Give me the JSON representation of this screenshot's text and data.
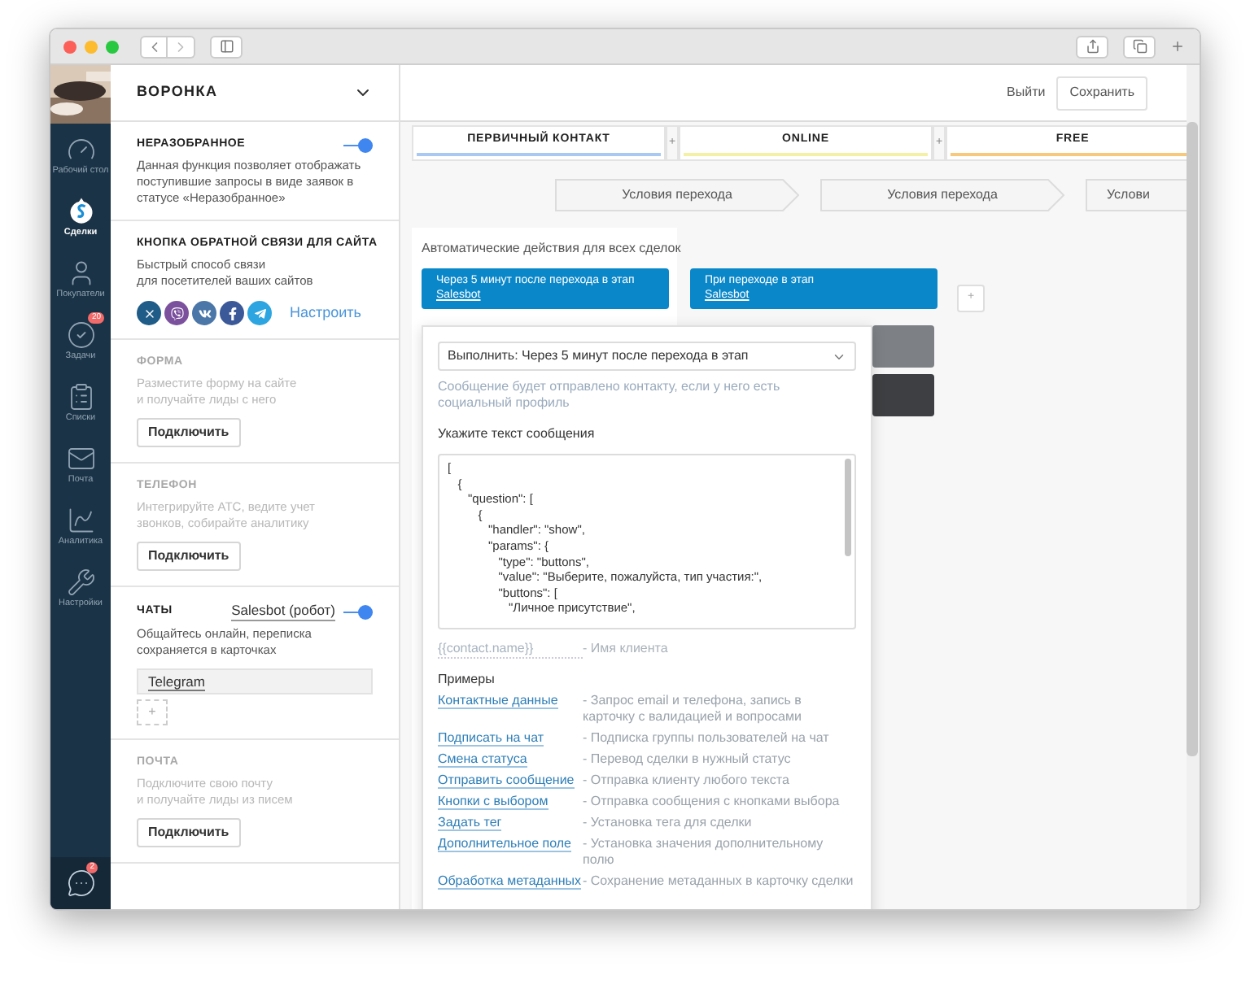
{
  "nav": {
    "items": [
      {
        "label": "Рабочий стол",
        "selected": false
      },
      {
        "label": "Сделки",
        "selected": true
      },
      {
        "label": "Покупатели",
        "selected": false
      },
      {
        "label": "Задачи",
        "selected": false,
        "badge": "20"
      },
      {
        "label": "Списки",
        "selected": false
      },
      {
        "label": "Почта",
        "selected": false
      },
      {
        "label": "Аналитика",
        "selected": false
      },
      {
        "label": "Настройки",
        "selected": false
      }
    ],
    "chat_badge": "2"
  },
  "panel": {
    "title": "ВОРОНКА",
    "sections": [
      {
        "title": "НЕРАЗОБРАННОЕ",
        "disabled": false,
        "toggle": {
          "on": true
        },
        "description": "Данная функция позволяет отображать\nпоступившие запросы в виде заявок в\nстатусе «Неразобранное»"
      },
      {
        "title": "КНОПКА ОБРАТНОЙ СВЯЗИ ДЛЯ САЙТА",
        "disabled": false,
        "description": "Быстрый способ связи\nдля посетителей ваших сайтов",
        "socials": [
          {
            "color": "#1f5c87"
          },
          {
            "color": "#7b519d"
          },
          {
            "color": "#4a76a8"
          },
          {
            "color": "#3b5998"
          },
          {
            "color": "#2ca5e0"
          }
        ],
        "link": "Настроить"
      },
      {
        "title": "ФОРМА",
        "disabled": true,
        "description": "Разместите форму на сайте\nи получайте лиды с него",
        "button": "Подключить"
      },
      {
        "title": "ТЕЛЕФОН",
        "disabled": true,
        "description": "Интегрируйте АТС, ведите учет\nзвонков, собирайте аналитику",
        "button": "Подключить"
      },
      {
        "title": "ЧАТЫ",
        "disabled": false,
        "toggle": {
          "on": true,
          "label": "Salesbot (робот)"
        },
        "description": "Общайтесь онлайн, переписка\nсохраняется в карточках",
        "channels": [
          "Telegram"
        ],
        "add_button": "+"
      },
      {
        "title": "ПОЧТА",
        "disabled": true,
        "description": "Подключите свою почту\nи получайте лиды из писем",
        "button": "Подключить"
      }
    ]
  },
  "toolbar": {
    "buttons": [
      {
        "label": "Выйти",
        "kind": "link"
      },
      {
        "label": "Сохранить",
        "kind": "outlined"
      }
    ]
  },
  "stages": [
    {
      "label": "ПЕРВИЧНЫЙ КОНТАКТ",
      "color": "#a9c9f2"
    },
    {
      "label": "ONLINE",
      "color": "#f4f1a6"
    },
    {
      "label": "FREE",
      "color": "#f6c97d"
    }
  ],
  "stage_separators": [
    "+",
    "+"
  ],
  "conditions": [
    "Условия перехода",
    "Условия перехода",
    "Услови"
  ],
  "automation": {
    "title": "Автоматические действия для всех сделок",
    "cards": [
      {
        "text": "Через 5 минут после перехода в этап",
        "link": "Salesbot"
      },
      {
        "text": "При переходе в этап",
        "link": "Salesbot"
      }
    ],
    "add_button": "+"
  },
  "popup": {
    "select": "Выполнить: Через 5 минут после перехода в этап",
    "hint": "Сообщение будет отправлено контакту, если у него есть социальный профиль",
    "label": "Укажите текст сообщения",
    "message": "[\n   {\n      \"question\": [\n         {\n            \"handler\": \"show\",\n            \"params\": {\n               \"type\": \"buttons\",\n               \"value\": \"Выберите, пожалуйста, тип участия:\",\n               \"buttons\": [\n                  \"Личное присутствие\",",
    "variable": {
      "name": "{{contact.name}}",
      "description": "- Имя клиента"
    },
    "examples_title": "Примеры",
    "examples": [
      {
        "name": "Контактные данные",
        "description": "- Запрос email и телефона, запись в карточку с валидацией и вопросами"
      },
      {
        "name": "Подписать на чат",
        "description": "- Подписка группы пользователей на чат"
      },
      {
        "name": "Смена статуса",
        "description": "- Перевод сделки в нужный статус"
      },
      {
        "name": "Отправить сообщение",
        "description": "- Отправка клиенту любого текста"
      },
      {
        "name": "Кнопки с выбором",
        "description": "- Отправка сообщения с кнопками выбора"
      },
      {
        "name": "Задать тег",
        "description": "- Установка тега для сделки"
      },
      {
        "name": "Дополнительное поле",
        "description": "- Установка значения дополнительному полю"
      },
      {
        "name": "Обработка метаданных",
        "description": "- Сохранение метаданных в карточку сделки"
      }
    ]
  }
}
